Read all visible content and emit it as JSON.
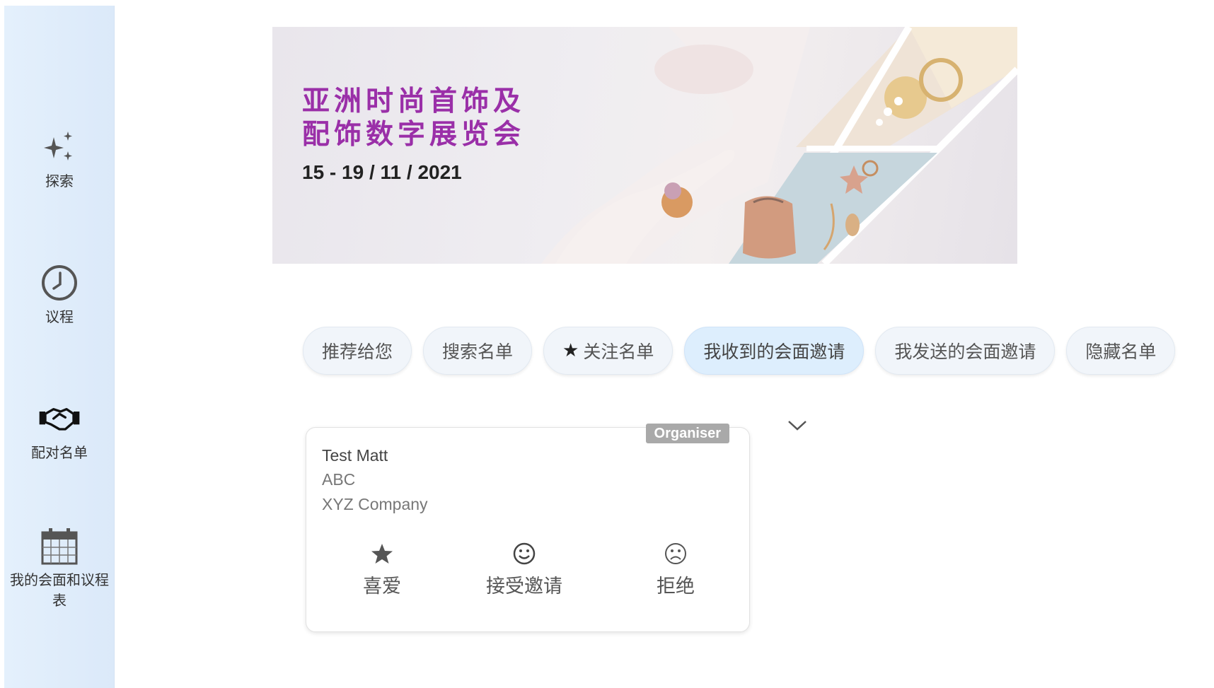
{
  "sidebar": {
    "items": [
      {
        "label": "探索",
        "icon": "sparkles-icon"
      },
      {
        "label": "议程",
        "icon": "clock-icon"
      },
      {
        "label": "配对名单",
        "icon": "handshake-icon"
      },
      {
        "label": "我的会面和议程表",
        "icon": "calendar-icon"
      }
    ]
  },
  "banner": {
    "title": "亚洲时尚首饰及\n配饰数字展览会",
    "date": "15 - 19 / 11 / 2021"
  },
  "tabs": [
    {
      "label": "推荐给您",
      "active": false
    },
    {
      "label": "搜索名单",
      "active": false
    },
    {
      "label": "关注名单",
      "active": false,
      "icon": "star-icon"
    },
    {
      "label": "我收到的会面邀请",
      "active": true
    },
    {
      "label": "我发送的会面邀请",
      "active": false
    },
    {
      "label": "隐藏名单",
      "active": false
    }
  ],
  "card": {
    "badge": "Organiser",
    "name": "Test Matt",
    "title": "ABC",
    "company": "XYZ Company",
    "actions": [
      {
        "label": "喜爱",
        "icon": "star-icon"
      },
      {
        "label": "接受邀请",
        "icon": "smile-icon"
      },
      {
        "label": "拒绝",
        "icon": "frown-icon"
      }
    ]
  },
  "colors": {
    "accent": "#9a2fa8",
    "sidebar_bg": "#e4f0fc",
    "active_tab": "#ddeefd"
  }
}
